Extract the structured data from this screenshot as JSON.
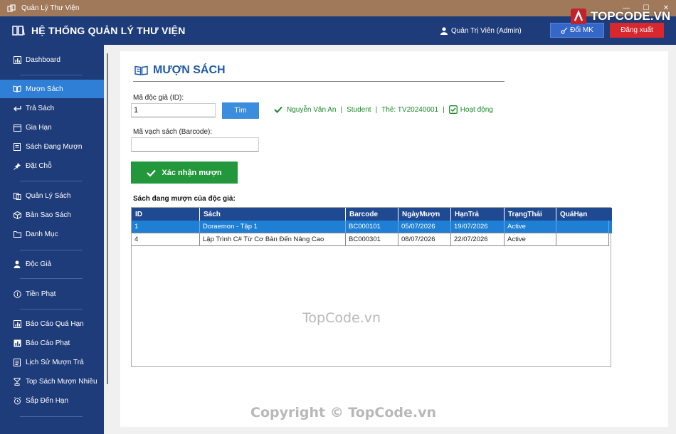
{
  "window": {
    "title": "Quản Lý Thư Viện",
    "controls": [
      "—",
      "☐",
      "✕"
    ]
  },
  "brand": {
    "text": "TOPCODE.VN"
  },
  "header": {
    "title": "HỆ THỐNG QUẢN LÝ THƯ VIỆN",
    "user": "Quản Trị Viên  (Admin)",
    "change_password": "Đổi MK",
    "logout": "Đăng xuất",
    "colors": {
      "bar": "#1f3c7a",
      "logout": "#d8282e",
      "change_password": "#3567c8"
    }
  },
  "sidebar": {
    "items": [
      {
        "label": "Dashboard",
        "icon": "chart-icon"
      },
      {
        "label": "Mượn Sách",
        "icon": "book-icon",
        "active": true
      },
      {
        "label": "Trả Sách",
        "icon": "return-icon"
      },
      {
        "label": "Gia Hạn",
        "icon": "calendar-icon"
      },
      {
        "label": "Sách Đang Mượn",
        "icon": "list-icon"
      },
      {
        "label": "Đặt Chỗ",
        "icon": "pin-icon"
      },
      {
        "label": "Quản Lý Sách",
        "icon": "books-icon"
      },
      {
        "label": "Bản Sao Sách",
        "icon": "box-icon"
      },
      {
        "label": "Danh Mục",
        "icon": "folder-icon"
      },
      {
        "label": "Độc Giả",
        "icon": "user-icon"
      },
      {
        "label": "Tiền Phạt",
        "icon": "money-icon"
      },
      {
        "label": "Báo Cáo Quá Hạn",
        "icon": "report-icon"
      },
      {
        "label": "Báo Cáo Phạt",
        "icon": "chart-icon"
      },
      {
        "label": "Lịch Sử Mượn Trả",
        "icon": "history-icon"
      },
      {
        "label": "Top Sách Mượn Nhiều",
        "icon": "trophy-icon"
      },
      {
        "label": "Sắp Đến Hạn",
        "icon": "alarm-icon"
      }
    ]
  },
  "borrow": {
    "title": "MƯỢN SÁCH",
    "reader_id_label": "Mã độc giả (ID):",
    "reader_id_value": "1",
    "find_button": "Tìm",
    "barcode_label": "Mã vạch sách (Barcode):",
    "barcode_value": "",
    "reader_info": {
      "name": "Nguyễn Văn An",
      "type": "Student",
      "card": "Thẻ: TV20240001",
      "status": "Hoạt động",
      "separator": "|"
    },
    "confirm_button": "Xác nhận mượn",
    "loans_title": "Sách đang mượn của độc giả:",
    "columns": [
      "ID",
      "Sách",
      "Barcode",
      "NgàyMượn",
      "HạnTrả",
      "TrạngThái",
      "QuáHạn"
    ],
    "rows": [
      {
        "id": "1",
        "book": "Doraemon - Tập 1",
        "barcode": "BC000101",
        "borrow_date": "05/07/2026",
        "due_date": "19/07/2026",
        "status": "Active",
        "overdue": "",
        "selected": true
      },
      {
        "id": "4",
        "book": "Lập Trình C# Từ Cơ Bản Đến Nâng Cao",
        "barcode": "BC000301",
        "borrow_date": "08/07/2026",
        "due_date": "22/07/2026",
        "status": "Active",
        "overdue": "",
        "selected": false
      }
    ]
  },
  "watermarks": {
    "center": "TopCode.vn",
    "bottom": "Copyright © TopCode.vn"
  }
}
